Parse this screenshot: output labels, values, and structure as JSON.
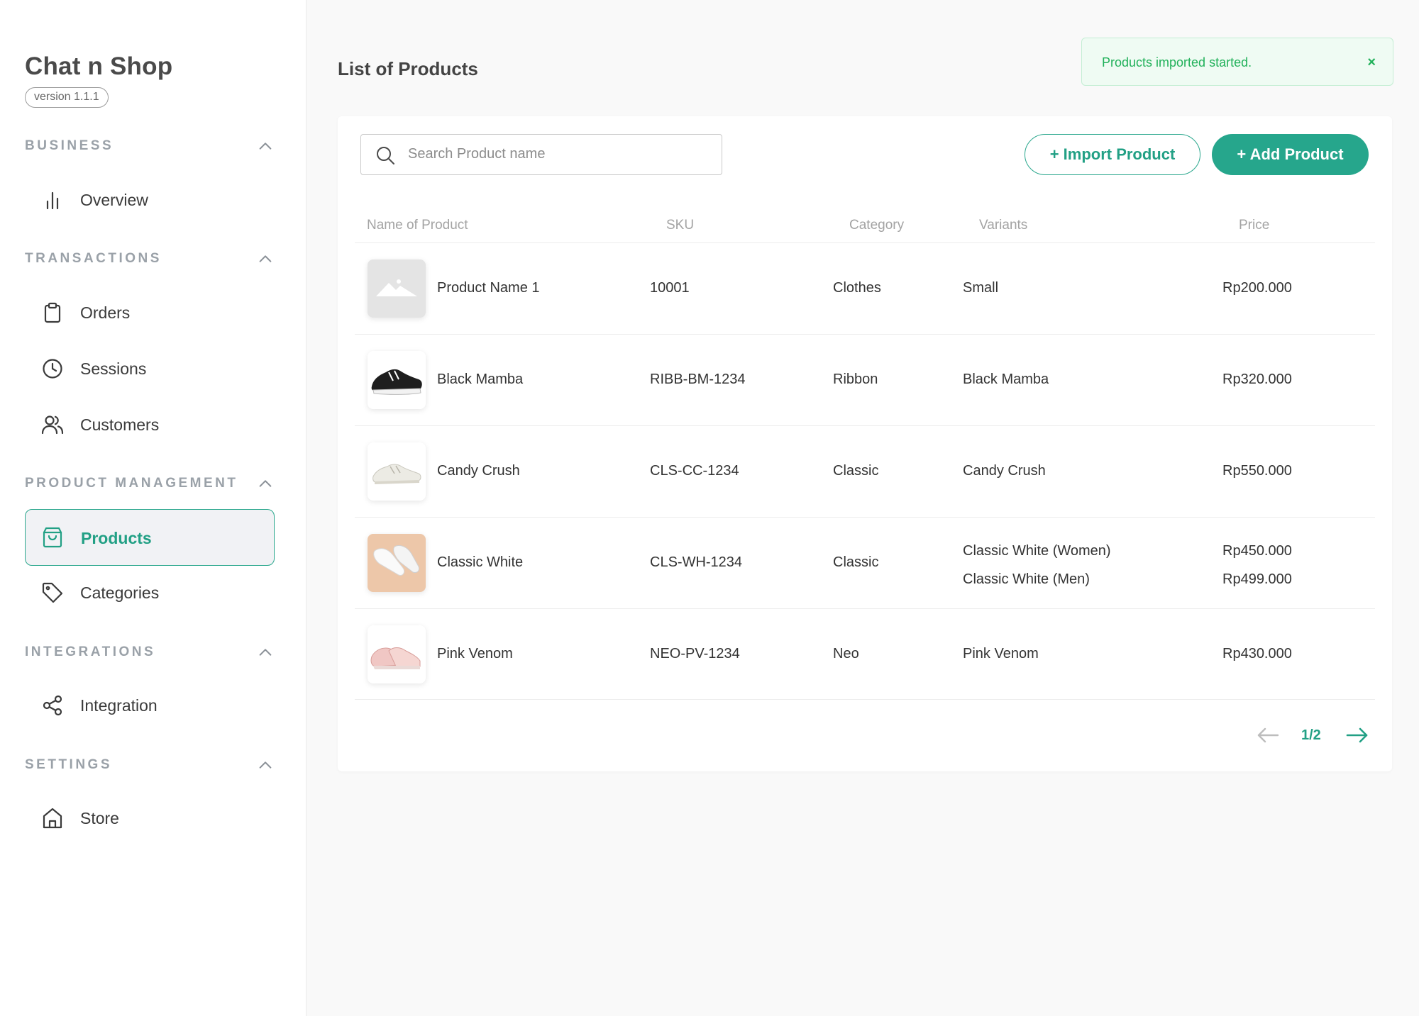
{
  "app": {
    "title": "Chat n Shop",
    "version": "version 1.1.1"
  },
  "sidebar": {
    "sections": [
      {
        "title": "BUSINESS",
        "items": [
          {
            "label": "Overview",
            "icon": "bar-chart-icon"
          }
        ]
      },
      {
        "title": "TRANSACTIONS",
        "items": [
          {
            "label": "Orders",
            "icon": "clipboard-icon"
          },
          {
            "label": "Sessions",
            "icon": "clock-icon"
          },
          {
            "label": "Customers",
            "icon": "users-icon"
          }
        ]
      },
      {
        "title": "PRODUCT MANAGEMENT",
        "items": [
          {
            "label": "Products",
            "icon": "shopping-bag-icon",
            "active": true
          },
          {
            "label": "Categories",
            "icon": "tag-icon"
          }
        ]
      },
      {
        "title": "INTEGRATIONS",
        "items": [
          {
            "label": "Integration",
            "icon": "share-icon"
          }
        ]
      },
      {
        "title": "SETTINGS",
        "items": [
          {
            "label": "Store",
            "icon": "home-icon"
          }
        ]
      }
    ]
  },
  "page": {
    "title": "List of Products"
  },
  "toast": {
    "message": "Products imported started.",
    "close": "×"
  },
  "toolbar": {
    "search_placeholder": "Search Product name",
    "import_label": "+ Import Product",
    "add_label": "+ Add Product"
  },
  "table": {
    "columns": [
      "Name of Product",
      "SKU",
      "Category",
      "Variants",
      "Price"
    ],
    "rows": [
      {
        "name": "Product Name 1",
        "sku": "10001",
        "category": "Clothes",
        "variants": [
          "Small"
        ],
        "prices": [
          "Rp200.000"
        ],
        "image": "placeholder-image-icon"
      },
      {
        "name": "Black Mamba",
        "sku": "RIBB-BM-1234",
        "category": "Ribbon",
        "variants": [
          "Black Mamba"
        ],
        "prices": [
          "Rp320.000"
        ],
        "image": "black-sneaker-image"
      },
      {
        "name": "Candy Crush",
        "sku": "CLS-CC-1234",
        "category": "Classic",
        "variants": [
          "Candy Crush"
        ],
        "prices": [
          "Rp550.000"
        ],
        "image": "cream-sneaker-image"
      },
      {
        "name": "Classic White",
        "sku": "CLS-WH-1234",
        "category": "Classic",
        "variants": [
          "Classic White (Women)",
          "Classic White (Men)"
        ],
        "prices": [
          "Rp450.000",
          "Rp499.000"
        ],
        "image": "white-sneaker-image"
      },
      {
        "name": "Pink Venom",
        "sku": "NEO-PV-1234",
        "category": "Neo",
        "variants": [
          "Pink Venom"
        ],
        "prices": [
          "Rp430.000"
        ],
        "image": "pink-sneaker-image"
      }
    ]
  },
  "pagination": {
    "text": "1/2"
  },
  "colors": {
    "accent": "#26a68c",
    "toast_bg": "#effbf3",
    "toast_text": "#21b15a",
    "muted": "#9aa1a8"
  }
}
